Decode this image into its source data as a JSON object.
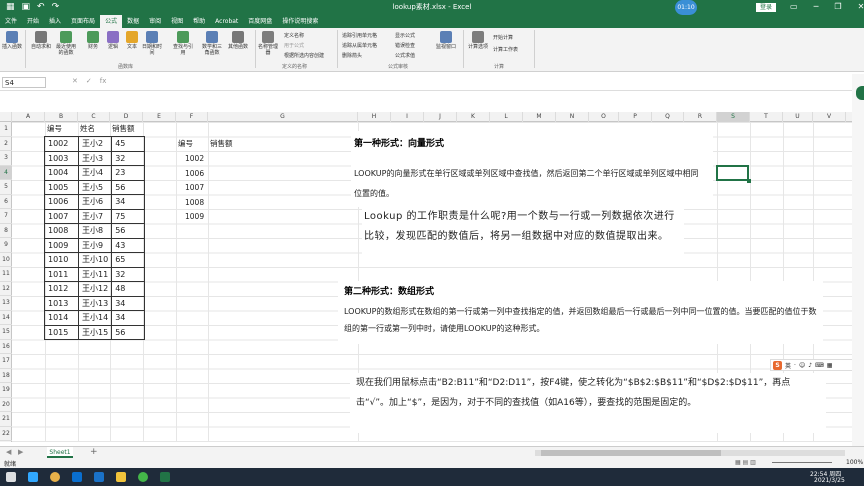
{
  "app": {
    "title": "lookup素材.xlsx - Excel",
    "user_badge": "01:10",
    "login_label": "登录"
  },
  "tabs": [
    "文件",
    "开始",
    "插入",
    "页面布局",
    "公式",
    "数据",
    "审阅",
    "视图",
    "帮助",
    "Acrobat",
    "百度网盘",
    "操作说明搜索"
  ],
  "active_tab": "公式",
  "ribbon": {
    "buttons": [
      "插入函数",
      "自动求和",
      "最近使用的函数",
      "财务",
      "逻辑",
      "文本",
      "日期和时间",
      "查找与引用",
      "数学和三角函数",
      "其他函数",
      "名称管理器",
      "监视窗口",
      "计算选项"
    ],
    "small_items": [
      "定义名称",
      "用于公式",
      "根据所选内容创建",
      "追踪引用单元格",
      "追踪从属单元格",
      "删除箭头",
      "显示公式",
      "错误检查",
      "公式求值",
      "开始计算",
      "计算工作表"
    ],
    "groups": [
      "函数库",
      "定义的名称",
      "公式审核",
      "计算"
    ]
  },
  "formula_bar": {
    "name_box": "S4",
    "icons": [
      "✕",
      "✓",
      "fx"
    ],
    "value": ""
  },
  "columns": [
    "A",
    "B",
    "C",
    "D",
    "E",
    "F",
    "G",
    "H",
    "I",
    "J",
    "K",
    "L",
    "M",
    "N",
    "O",
    "P",
    "Q",
    "R",
    "S",
    "T",
    "U",
    "V"
  ],
  "selected_column": "S",
  "rows": [
    "1",
    "2",
    "3",
    "4",
    "5",
    "6",
    "7",
    "8",
    "9",
    "10",
    "11",
    "12",
    "13",
    "14",
    "15",
    "16",
    "17",
    "18",
    "19",
    "20",
    "21",
    "22"
  ],
  "selected_row": "4",
  "table": {
    "headers": [
      "编号",
      "姓名",
      "销售额"
    ],
    "rows": [
      [
        "1002",
        "王小2",
        "45"
      ],
      [
        "1003",
        "王小3",
        "32"
      ],
      [
        "1004",
        "王小4",
        "23"
      ],
      [
        "1005",
        "王小5",
        "56"
      ],
      [
        "1006",
        "王小6",
        "34"
      ],
      [
        "1007",
        "王小7",
        "75"
      ],
      [
        "1008",
        "王小8",
        "56"
      ],
      [
        "1009",
        "王小9",
        "43"
      ],
      [
        "1010",
        "王小10",
        "65"
      ],
      [
        "1011",
        "王小11",
        "32"
      ],
      [
        "1012",
        "王小12",
        "48"
      ],
      [
        "1013",
        "王小13",
        "34"
      ],
      [
        "1014",
        "王小14",
        "34"
      ],
      [
        "1015",
        "王小15",
        "56"
      ]
    ]
  },
  "lookup": {
    "headers": [
      "编号",
      "销售额"
    ],
    "ids": [
      "1002",
      "1006",
      "1007",
      "1008",
      "1009"
    ]
  },
  "overlay": {
    "form1_heading": "第一种形式：向量形式",
    "form1_desc": "LOOKUP的向量形式在单行区域或单列区域中查找值，然后返回第二个单行区域或单列区域中相同位置的值。",
    "lookup_duty": "Lookup 的工作职责是什么呢?用一个数与一行或一列数据依次进行比较，发现匹配的数值后，将另一组数据中对应的数值提取出来。",
    "form2_heading": "第二种形式：数组形式",
    "form2_desc": "LOOKUP的数组形式在数组的第一行或第一列中查找指定的值，并返回数组最后一行或最后一列中同一位置的值。当要匹配的值位于数组的第一行或第一列中时，请使用LOOKUP的这种形式。",
    "instruction": "现在我们用鼠标点击“B2:B11”和“D2:D11”，按F4键，使之转化为“$B$2:$B$11”和“$D$2:$D$11”，再点击“√”。加上“$”，是因为，对于不同的查找值（如A16等），要查找的范围是固定的。"
  },
  "ime": {
    "logo": "S",
    "lang": "英"
  },
  "sheet": {
    "name": "Sheet1",
    "add": "+"
  },
  "status": {
    "mode": "就绪",
    "zoom": "100%"
  },
  "taskbar": {
    "time": "22:54 周四",
    "date": "2021/3/25"
  },
  "colors": {
    "excel_green": "#217346",
    "selection": "#217346"
  }
}
